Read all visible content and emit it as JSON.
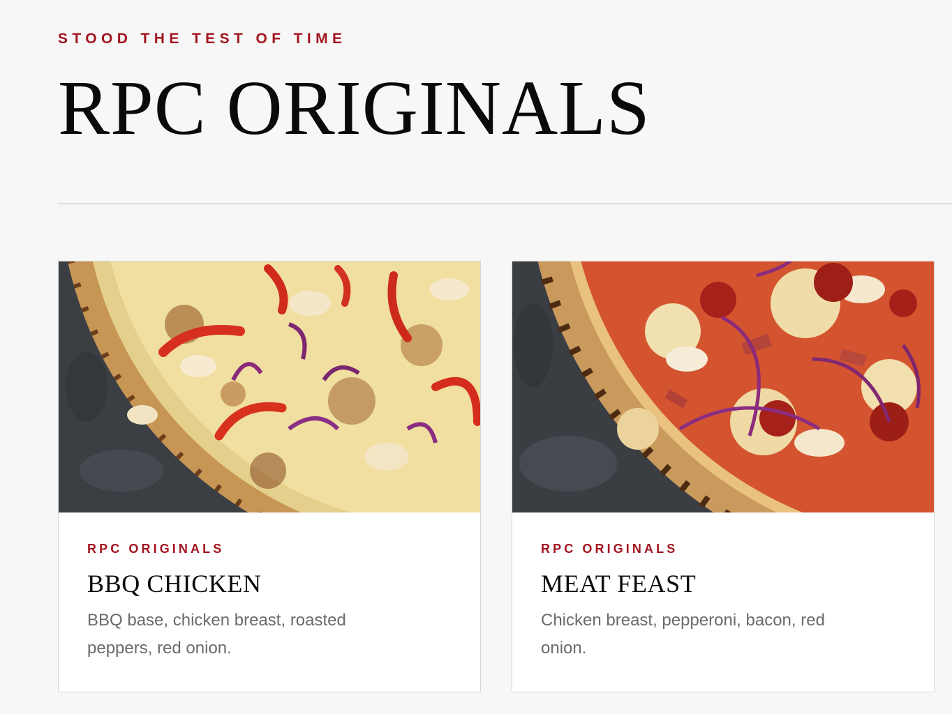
{
  "section": {
    "eyebrow": "STOOD THE TEST OF TIME",
    "title": "RPC ORIGINALS"
  },
  "colors": {
    "accent": "#a3151f",
    "background": "#f7f7f7",
    "card": "#ffffff",
    "text": "#0a0a0a",
    "muted": "#6b6b6b"
  },
  "cards": [
    {
      "category": "RPC ORIGINALS",
      "name": "BBQ CHICKEN",
      "description": "BBQ base, chicken breast, roasted peppers, red onion.",
      "image": "bbq-chicken-pizza-photo"
    },
    {
      "category": "RPC ORIGINALS",
      "name": "MEAT FEAST",
      "description": "Chicken breast, pepperoni, bacon, red onion.",
      "image": "meat-feast-pizza-photo"
    }
  ]
}
